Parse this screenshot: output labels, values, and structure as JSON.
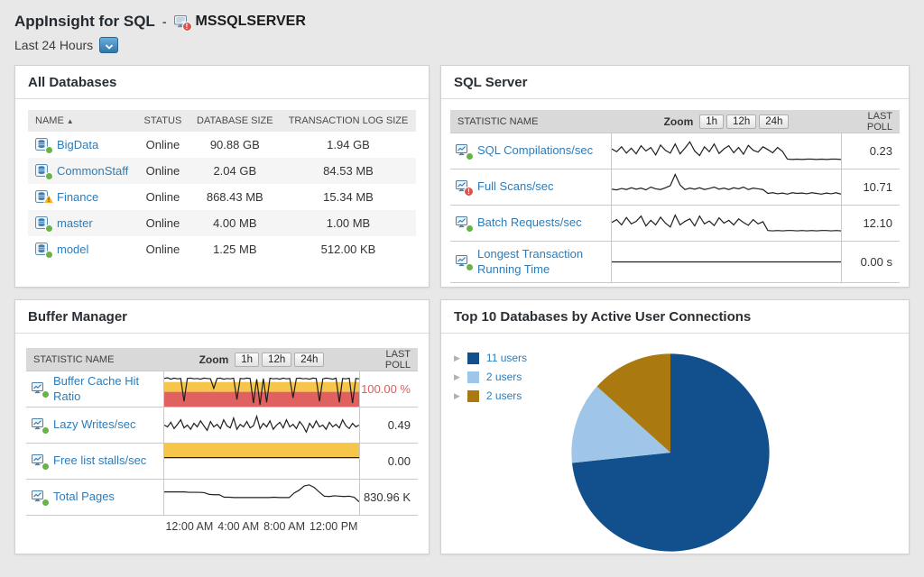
{
  "colors": {
    "link": "#2e7cb8",
    "status_up": "#67b346",
    "status_critical": "#d9534f",
    "status_warning": "#f5b324",
    "alert_value": "#e05c5c",
    "band_yellow": "#f6c64a",
    "band_red": "#e16060",
    "sparkline": "#1f1f1f",
    "pie": [
      "#11508c",
      "#9fc6e8",
      "#aa7a10"
    ]
  },
  "header": {
    "app_title": "AppInsight for SQL",
    "separator": "-",
    "server_name": "MSSQLSERVER",
    "server_status": "critical",
    "time_range": "Last 24 Hours"
  },
  "panels": {
    "all_databases": {
      "title": "All Databases",
      "columns": [
        "NAME",
        "STATUS",
        "DATABASE SIZE",
        "TRANSACTION LOG SIZE"
      ],
      "sort": {
        "column": "NAME",
        "direction": "ascending",
        "arrow": "▲"
      },
      "rows": [
        {
          "name": "BigData",
          "status_icon": "up",
          "status": "Online",
          "database_size": "90.88 GB",
          "transaction_log_size": "1.94 GB"
        },
        {
          "name": "CommonStaff",
          "status_icon": "up",
          "status": "Online",
          "database_size": "2.04 GB",
          "transaction_log_size": "84.53 MB"
        },
        {
          "name": "Finance",
          "status_icon": "warning",
          "status": "Online",
          "database_size": "868.43 MB",
          "transaction_log_size": "15.34 MB"
        },
        {
          "name": "master",
          "status_icon": "up",
          "status": "Online",
          "database_size": "4.00 MB",
          "transaction_log_size": "1.00 MB"
        },
        {
          "name": "model",
          "status_icon": "up",
          "status": "Online",
          "database_size": "1.25 MB",
          "transaction_log_size": "512.00 KB"
        }
      ]
    },
    "sql_server": {
      "title": "SQL Server",
      "table_header": {
        "statistic": "STATISTIC NAME",
        "zoom_label": "Zoom",
        "zoom_options": [
          "1h",
          "12h",
          "24h"
        ],
        "last_poll": "LAST POLL"
      },
      "rows": [
        {
          "name": "SQL Compilations/sec",
          "status": "up",
          "last_poll": "0.23",
          "chart": 0
        },
        {
          "name": "Full Scans/sec",
          "status": "critical",
          "last_poll": "10.71",
          "chart": 1
        },
        {
          "name": "Batch Requests/sec",
          "status": "up",
          "last_poll": "12.10",
          "chart": 2
        },
        {
          "name": "Longest Transaction Running Time",
          "status": "up",
          "last_poll": "0.00 s",
          "chart": 3
        }
      ]
    },
    "buffer_manager": {
      "title": "Buffer Manager",
      "table_header": {
        "statistic": "STATISTIC NAME",
        "zoom_label": "Zoom",
        "zoom_options": [
          "1h",
          "12h",
          "24h"
        ],
        "last_poll": "LAST POLL"
      },
      "rows": [
        {
          "name": "Buffer Cache Hit Ratio",
          "status": "up",
          "last_poll": "100.00 %",
          "critical_value": true,
          "chart": 4
        },
        {
          "name": "Lazy Writes/sec",
          "status": "up",
          "last_poll": "0.49",
          "chart": 5
        },
        {
          "name": "Free list stalls/sec",
          "status": "up",
          "last_poll": "0.00",
          "chart": 6
        },
        {
          "name": "Total Pages",
          "status": "up",
          "last_poll": "830.96 K",
          "chart": 7
        }
      ],
      "time_axis": [
        "12:00 AM",
        "4:00 AM",
        "8:00 AM",
        "12:00 PM"
      ]
    },
    "top_10": {
      "title": "Top 10 Databases by Active User Connections"
    }
  },
  "chart_data": [
    {
      "type": "line",
      "title": "SQL Compilations/sec",
      "panel": "SQL Server",
      "last_poll": "0.23",
      "y_scale": "relative position 0-100 from top",
      "grid": false,
      "values": [
        44,
        52,
        38,
        56,
        42,
        58,
        35,
        50,
        40,
        61,
        33,
        48,
        56,
        30,
        58,
        42,
        24,
        50,
        63,
        38,
        52,
        30,
        57,
        44,
        35,
        55,
        40,
        59,
        34,
        48,
        53,
        38,
        46,
        55,
        40,
        51,
        73,
        74,
        73,
        74,
        73,
        73,
        74,
        73,
        74,
        73,
        73,
        74
      ]
    },
    {
      "type": "line",
      "title": "Full Scans/sec",
      "panel": "SQL Server",
      "last_poll": "10.71",
      "y_scale": "relative position 0-100 from top",
      "grid": false,
      "values": [
        56,
        58,
        54,
        57,
        52,
        56,
        53,
        58,
        50,
        55,
        57,
        52,
        46,
        14,
        44,
        57,
        53,
        56,
        52,
        57,
        54,
        50,
        56,
        53,
        57,
        52,
        55,
        50,
        57,
        53,
        55,
        57,
        68,
        66,
        69,
        67,
        70,
        66,
        68,
        67,
        69,
        66,
        68,
        70,
        67,
        69,
        66,
        70
      ]
    },
    {
      "type": "line",
      "title": "Batch Requests/sec",
      "panel": "SQL Server",
      "last_poll": "12.10",
      "y_scale": "relative position 0-100 from top",
      "grid": false,
      "values": [
        48,
        40,
        55,
        34,
        52,
        45,
        30,
        58,
        42,
        55,
        33,
        50,
        61,
        27,
        55,
        45,
        38,
        58,
        30,
        52,
        44,
        57,
        35,
        50,
        42,
        55,
        38,
        48,
        56,
        40,
        52,
        46,
        71,
        72,
        71,
        72,
        71,
        71,
        72,
        71,
        72,
        71,
        72,
        71,
        71,
        72,
        71,
        72
      ]
    },
    {
      "type": "line",
      "title": "Longest Transaction Running Time",
      "panel": "SQL Server",
      "last_poll": "0.00 s",
      "y_scale": "relative position 0-100 from top",
      "grid": false,
      "values": [
        50,
        50
      ]
    },
    {
      "type": "line",
      "title": "Buffer Cache Hit Ratio",
      "panel": "Buffer Manager",
      "last_poll": "100.00 %",
      "critical": true,
      "y_scale": "relative position 0-100 from top",
      "grid": false,
      "bands": [
        {
          "from": 30,
          "to": 58,
          "color": "#f6c64a"
        },
        {
          "from": 58,
          "to": 100,
          "color": "#e16060"
        }
      ],
      "values": [
        20,
        18,
        22,
        19,
        21,
        20,
        85,
        20,
        19,
        21,
        20,
        22,
        19,
        20,
        21,
        48,
        20,
        19,
        22,
        20,
        21,
        19,
        80,
        20,
        21,
        19,
        20,
        90,
        22,
        95,
        20,
        88,
        19,
        21,
        20,
        22,
        19,
        21,
        20,
        75,
        20,
        19,
        21,
        20,
        22,
        19,
        20,
        85,
        21,
        19,
        20,
        22,
        19,
        88,
        20,
        21,
        19,
        90,
        20,
        21
      ]
    },
    {
      "type": "line",
      "title": "Lazy Writes/sec",
      "panel": "Buffer Manager",
      "last_poll": "0.49",
      "y_scale": "relative position 0-100 from top",
      "grid": false,
      "values": [
        50,
        55,
        42,
        60,
        48,
        35,
        58,
        50,
        62,
        45,
        55,
        38,
        52,
        65,
        40,
        55,
        48,
        60,
        35,
        52,
        58,
        30,
        62,
        48,
        55,
        40,
        58,
        52,
        25,
        60,
        45,
        55,
        38,
        62,
        50,
        42,
        58,
        35,
        55,
        48,
        60,
        40,
        52,
        70,
        45,
        58,
        38,
        55,
        50,
        62,
        42,
        55,
        48,
        58,
        35,
        52,
        60,
        45,
        55,
        50
      ]
    },
    {
      "type": "line",
      "title": "Free list stalls/sec",
      "panel": "Buffer Manager",
      "last_poll": "0.00",
      "y_scale": "relative position 0-100 from top",
      "grid": false,
      "bands": [
        {
          "from": 0,
          "to": 40,
          "color": "#f6c64a"
        }
      ],
      "values": [
        40,
        40
      ]
    },
    {
      "type": "line",
      "title": "Total Pages",
      "panel": "Buffer Manager",
      "last_poll": "830.96 K",
      "y_scale": "relative position 0-100 from top",
      "grid": false,
      "x_tick_labels": [
        "12:00 AM",
        "4:00 AM",
        "8:00 AM",
        "12:00 PM"
      ],
      "values": [
        35,
        35,
        35,
        35,
        35,
        36,
        36,
        36,
        37,
        42,
        43,
        43,
        50,
        50,
        51,
        51,
        51,
        51,
        51,
        51,
        51,
        51,
        50,
        51,
        51,
        51,
        38,
        30,
        18,
        15,
        22,
        35,
        47,
        48,
        46,
        47,
        48,
        47,
        50,
        63
      ]
    },
    {
      "type": "pie",
      "title": "Top 10 Databases by Active User Connections",
      "labels": [
        "11 users",
        "2 users",
        "2 users"
      ],
      "values": [
        11,
        2,
        2
      ],
      "colors": [
        "#11508c",
        "#9fc6e8",
        "#aa7a10"
      ],
      "start_angle": "12 o'clock, clockwise",
      "legend_position": "top-left"
    }
  ]
}
